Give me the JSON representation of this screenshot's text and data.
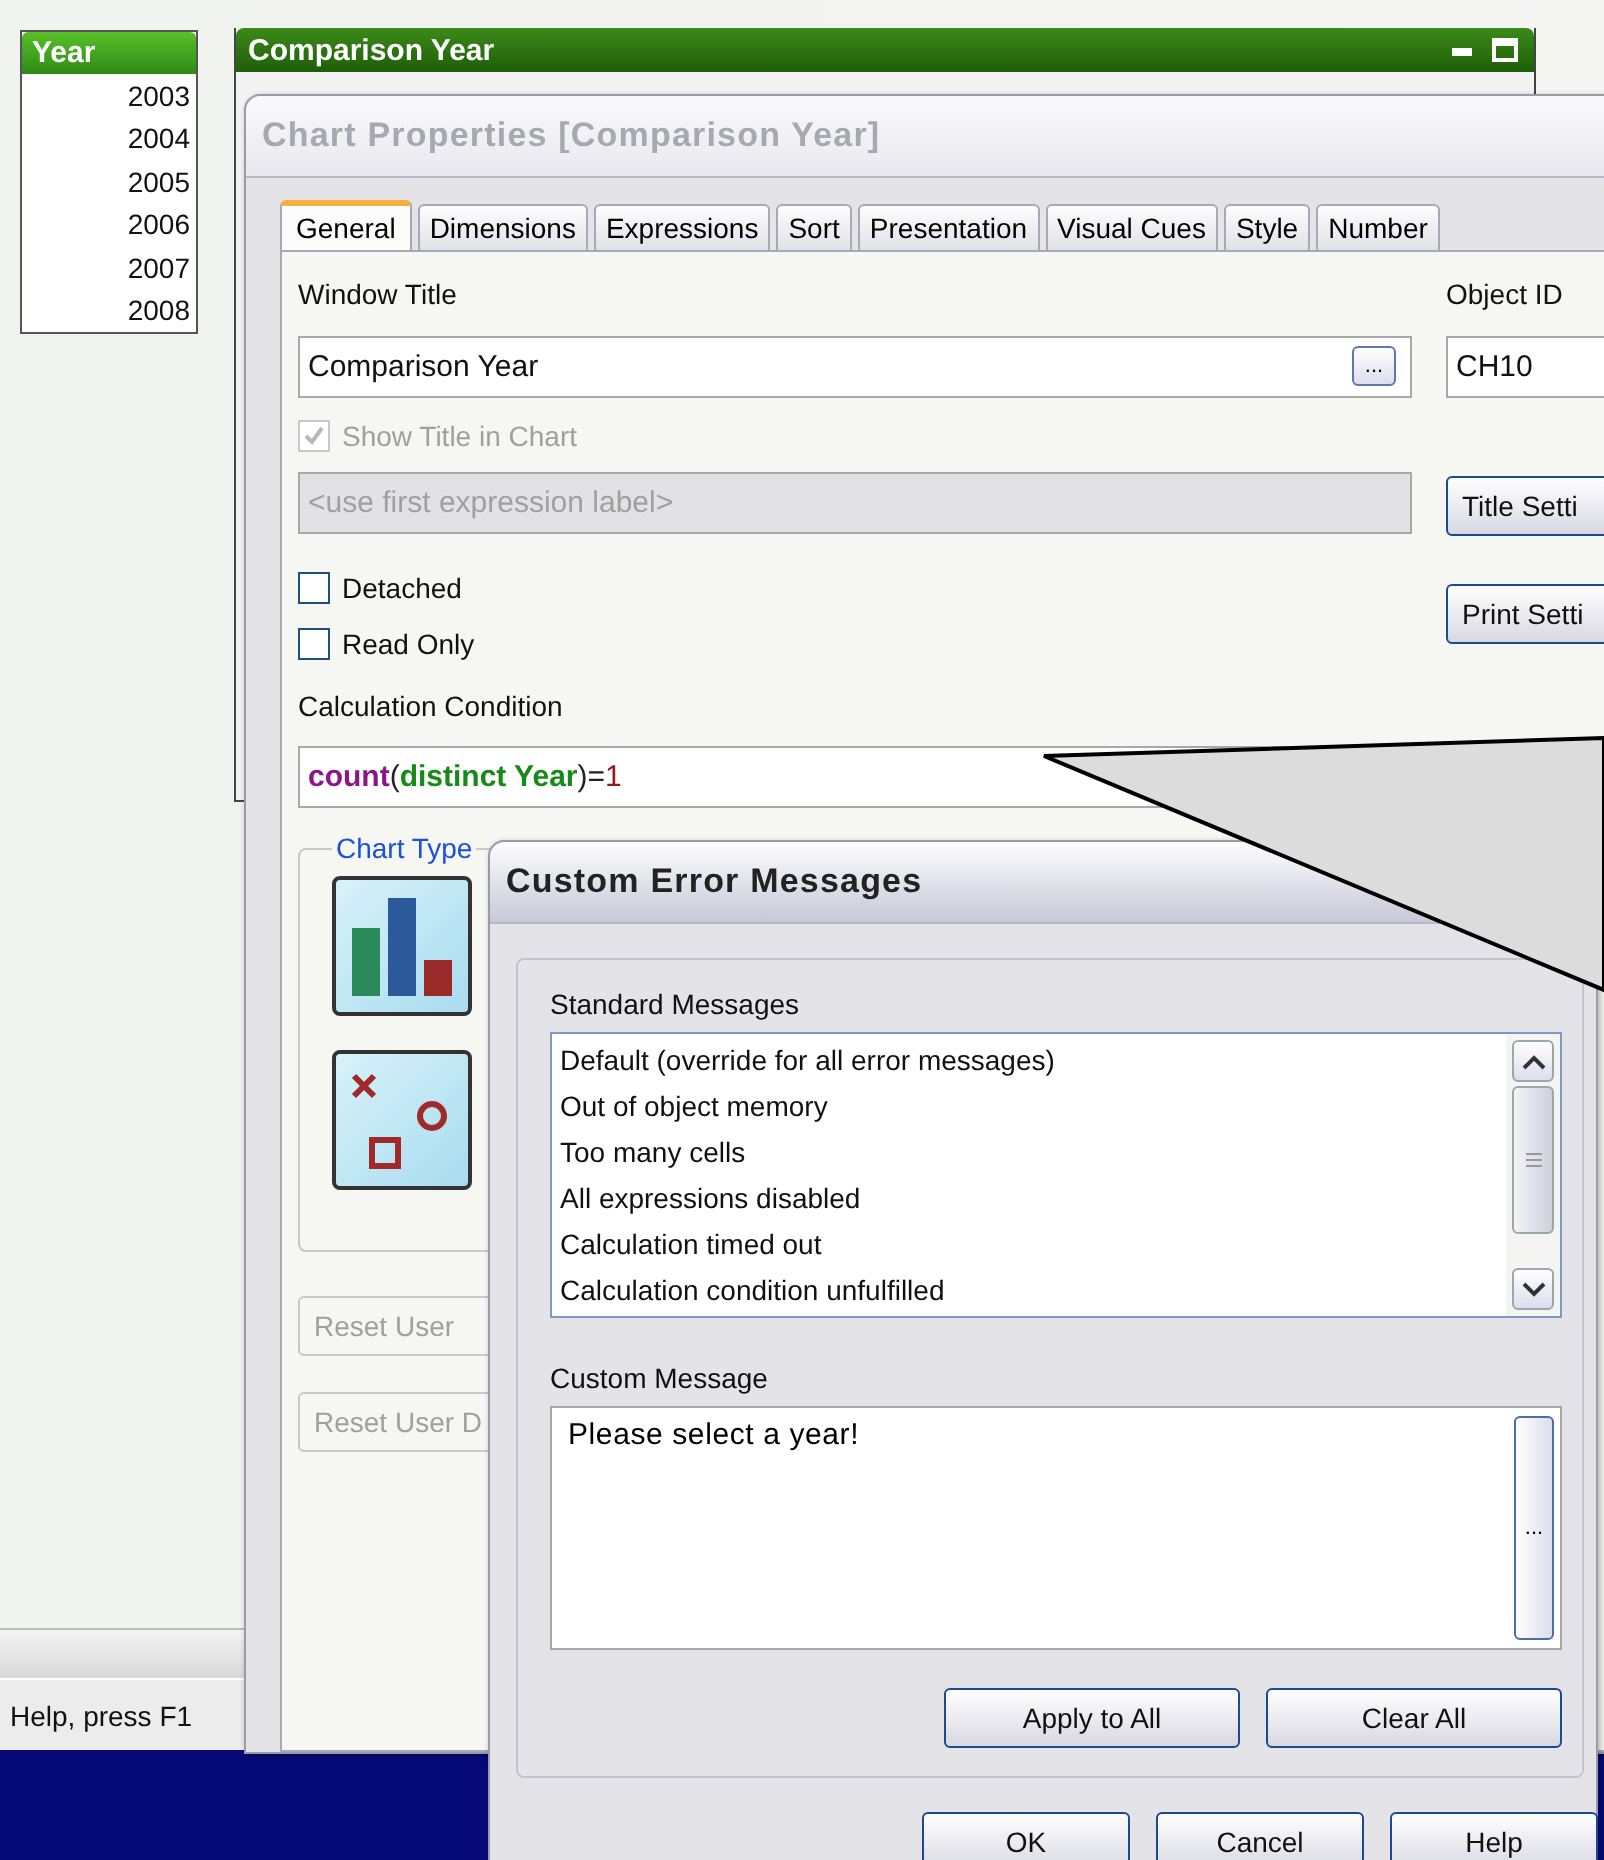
{
  "year_list": {
    "title": "Year",
    "items": [
      "2003",
      "2004",
      "2005",
      "2006",
      "2007",
      "2008"
    ]
  },
  "chart_window": {
    "title": "Comparison Year"
  },
  "status_bar": {
    "text": "Help, press F1"
  },
  "properties_dialog": {
    "title": "Chart Properties [Comparison Year]",
    "tabs": [
      {
        "label": "General",
        "selected": true
      },
      {
        "label": "Dimensions",
        "selected": false
      },
      {
        "label": "Expressions",
        "selected": false
      },
      {
        "label": "Sort",
        "selected": false
      },
      {
        "label": "Presentation",
        "selected": false
      },
      {
        "label": "Visual Cues",
        "selected": false
      },
      {
        "label": "Style",
        "selected": false
      },
      {
        "label": "Number",
        "selected": false
      }
    ],
    "window_title": {
      "label": "Window Title",
      "value": "Comparison Year",
      "browse": "..."
    },
    "object_id": {
      "label": "Object ID",
      "value": "CH10"
    },
    "show_title": {
      "label": "Show Title in Chart",
      "checked": true,
      "disabled": true
    },
    "title_label": {
      "placeholder": "<use first expression label>",
      "disabled": true
    },
    "side_buttons": [
      "Title Setti",
      "Print Setti"
    ],
    "options": [
      {
        "label": "Detached",
        "checked": false
      },
      {
        "label": "Read Only",
        "checked": false
      }
    ],
    "calculation_condition": {
      "label": "Calculation Condition",
      "segments": [
        {
          "text": "count",
          "kind": "function"
        },
        {
          "text": "(",
          "kind": "plain"
        },
        {
          "text": "distinct Year",
          "kind": "keyword"
        },
        {
          "text": ")=",
          "kind": "plain"
        },
        {
          "text": "1",
          "kind": "number"
        }
      ]
    },
    "chart_type": {
      "label": "Chart Type",
      "types": [
        {
          "kind": "bar",
          "selected": false
        },
        {
          "kind": "scatter",
          "selected": false
        }
      ]
    },
    "reset_buttons": [
      {
        "label": "Reset User",
        "disabled": true
      },
      {
        "label": "Reset User D",
        "disabled": true
      }
    ]
  },
  "error_dialog": {
    "title": "Custom Error Messages",
    "standard_label": "Standard Messages",
    "messages": [
      "Default (override for all error messages)",
      "Out of object memory",
      "Too many cells",
      "All expressions disabled",
      "Calculation timed out",
      "Calculation condition unfulfilled"
    ],
    "custom_label": "Custom Message",
    "custom_value": "Please select a year!",
    "custom_browse": "...",
    "group_buttons": [
      "Apply to All",
      "Clear All"
    ],
    "buttons": [
      "OK",
      "Cancel",
      "Help"
    ]
  }
}
